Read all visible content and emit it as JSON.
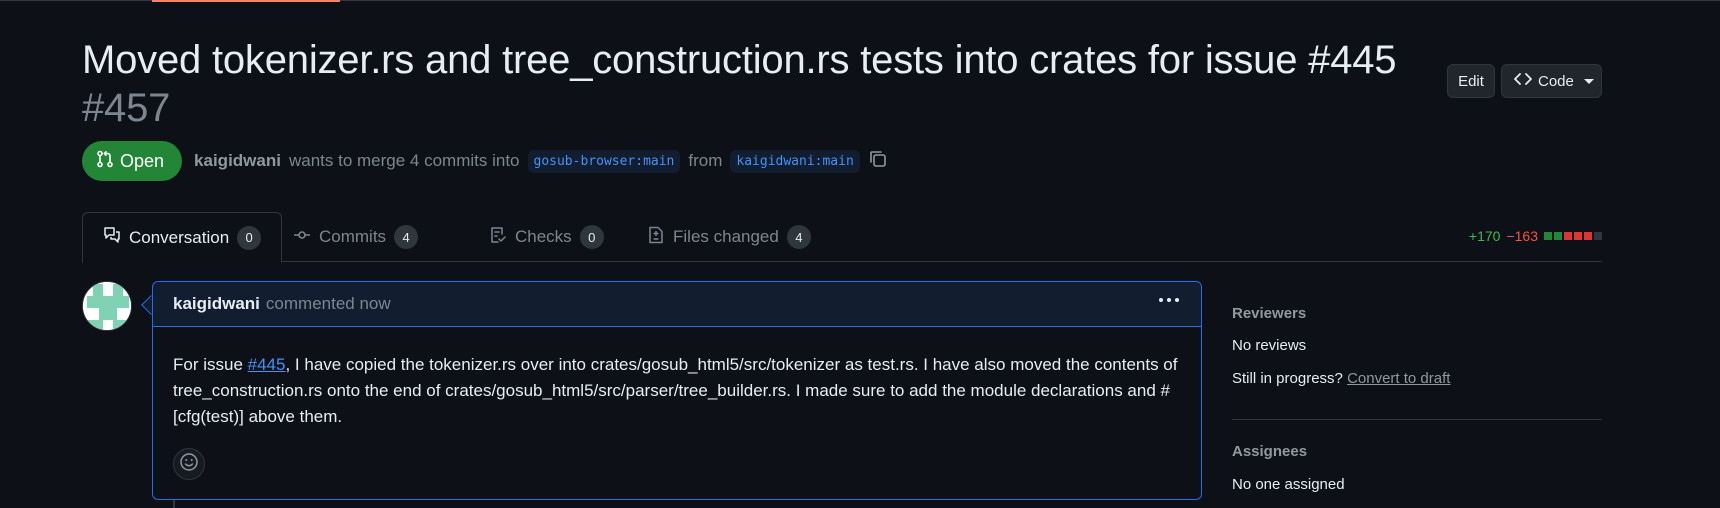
{
  "pr": {
    "title": "Moved tokenizer.rs and tree_construction.rs tests into crates for issue #445",
    "number": "#457",
    "state": "Open",
    "author": "kaigidwani",
    "merge_text": "wants to merge 4 commits into",
    "base_branch": "gosub-browser:main",
    "from_text": "from",
    "head_branch": "kaigidwani:main"
  },
  "header_buttons": {
    "edit": "Edit",
    "code": "Code"
  },
  "tabs": [
    {
      "label": "Conversation",
      "count": "0",
      "icon": "comment-discussion-icon"
    },
    {
      "label": "Commits",
      "count": "4",
      "icon": "git-commit-icon"
    },
    {
      "label": "Checks",
      "count": "0",
      "icon": "checklist-icon"
    },
    {
      "label": "Files changed",
      "count": "4",
      "icon": "file-diff-icon"
    }
  ],
  "diffstat": {
    "additions": "+170",
    "deletions": "−163",
    "blocks": [
      "#238636",
      "#238636",
      "#da3633",
      "#da3633",
      "#da3633",
      "#30363d"
    ]
  },
  "comment": {
    "author": "kaigidwani",
    "time": "commented now",
    "body_before_link": "For issue ",
    "link": "#445",
    "body_after_link": ", I have copied the tokenizer.rs over into crates/gosub_html5/src/tokenizer as test.rs. I have also moved the contents of tree_construction.rs onto the end of crates/gosub_html5/src/parser/tree_builder.rs. I made sure to add the module declarations and #[cfg(test)] above them."
  },
  "sidebar": {
    "reviewers_heading": "Reviewers",
    "reviewers_value": "No reviews",
    "progress_text": "Still in progress?",
    "convert_link": "Convert to draft",
    "assignees_heading": "Assignees",
    "assignees_value": "No one assigned"
  },
  "colors": {
    "background": "#0d1117",
    "open_green": "#238636",
    "accent_blue": "#1f6feb",
    "link_blue": "#4493f8",
    "additions": "#3fb950",
    "deletions": "#f85149"
  }
}
